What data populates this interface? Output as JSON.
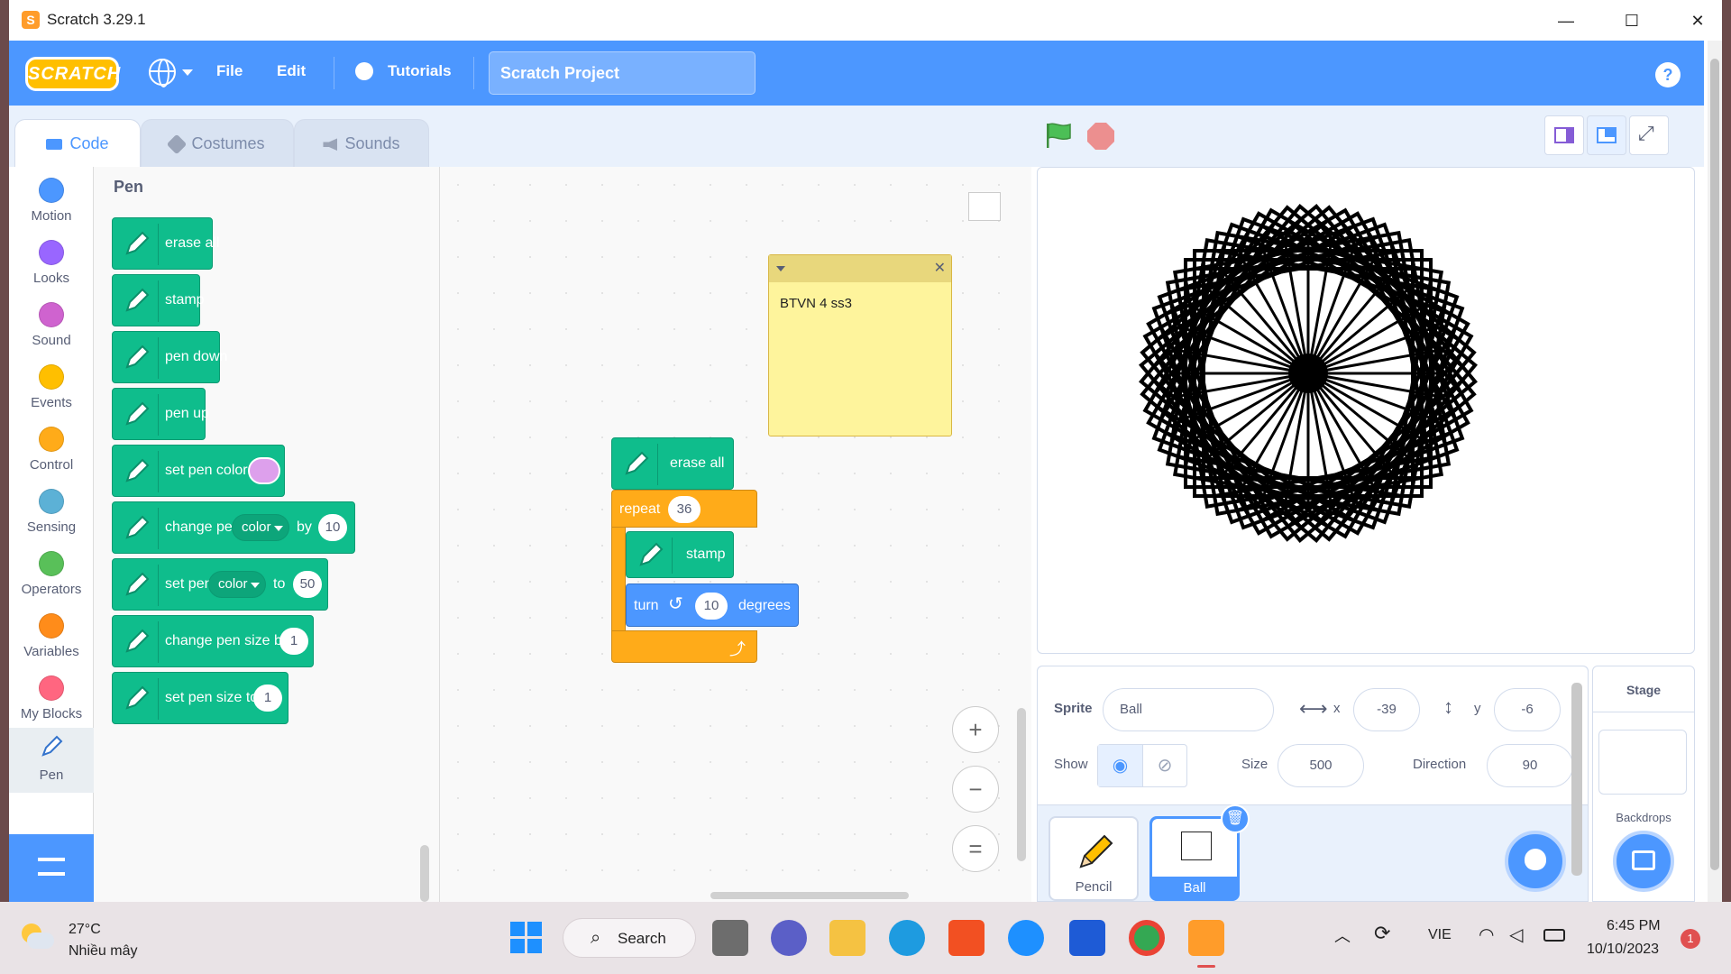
{
  "window": {
    "title": "Scratch 3.29.1",
    "minimize": "—",
    "maximize": "☐",
    "close": "✕"
  },
  "menubar": {
    "logo": "SCRATCH",
    "file": "File",
    "edit": "Edit",
    "tutorials": "Tutorials",
    "project_title": "Scratch Project",
    "help": "?"
  },
  "tabs": {
    "code": "Code",
    "costumes": "Costumes",
    "sounds": "Sounds"
  },
  "categories": [
    {
      "label": "Motion",
      "color": "#4c97ff"
    },
    {
      "label": "Looks",
      "color": "#9966ff"
    },
    {
      "label": "Sound",
      "color": "#cf63cf"
    },
    {
      "label": "Events",
      "color": "#ffbf00"
    },
    {
      "label": "Control",
      "color": "#ffab19"
    },
    {
      "label": "Sensing",
      "color": "#5cb1d6"
    },
    {
      "label": "Operators",
      "color": "#59c059"
    },
    {
      "label": "Variables",
      "color": "#ff8c1a"
    },
    {
      "label": "My Blocks",
      "color": "#ff6680"
    },
    {
      "label": "Pen",
      "color": "#0fbd8c"
    }
  ],
  "palette": {
    "heading": "Pen",
    "erase_all": "erase all",
    "stamp": "stamp",
    "pen_down": "pen down",
    "pen_up": "pen up",
    "set_pen_color_to": "set pen color to",
    "pen_color_swatch": "#dda0ec",
    "change_pen": "change pen",
    "change_pen_dropdown": "color",
    "by": "by",
    "change_pen_value": "10",
    "set_pen": "set pen",
    "set_pen_dropdown": "color",
    "to": "to",
    "set_pen_value": "50",
    "change_pen_size_by": "change pen size by",
    "change_pen_size_value": "1",
    "set_pen_size_to": "set pen size to",
    "set_pen_size_value": "1"
  },
  "script": {
    "erase_all": "erase all",
    "repeat": "repeat",
    "repeat_count": "36",
    "stamp": "stamp",
    "turn": "turn",
    "turn_value": "10",
    "degrees": "degrees"
  },
  "note": {
    "text": "BTVN 4 ss3"
  },
  "zoom": {
    "in": "+",
    "out": "−",
    "reset": "="
  },
  "sprite": {
    "sprite_label": "Sprite",
    "name": "Ball",
    "x_label": "x",
    "x": "-39",
    "y_label": "y",
    "y": "-6",
    "show_label": "Show",
    "size_label": "Size",
    "size": "500",
    "direction_label": "Direction",
    "direction": "90"
  },
  "sprites": [
    {
      "name": "Pencil"
    },
    {
      "name": "Ball"
    }
  ],
  "stage_panel": {
    "title": "Stage",
    "backdrops": "Backdrops"
  },
  "taskbar": {
    "weather_temp": "27°C",
    "weather_desc": "Nhiều mây",
    "search": "Search",
    "lang": "VIE",
    "time": "6:45 PM",
    "date": "10/10/2023",
    "notif_count": "1"
  }
}
